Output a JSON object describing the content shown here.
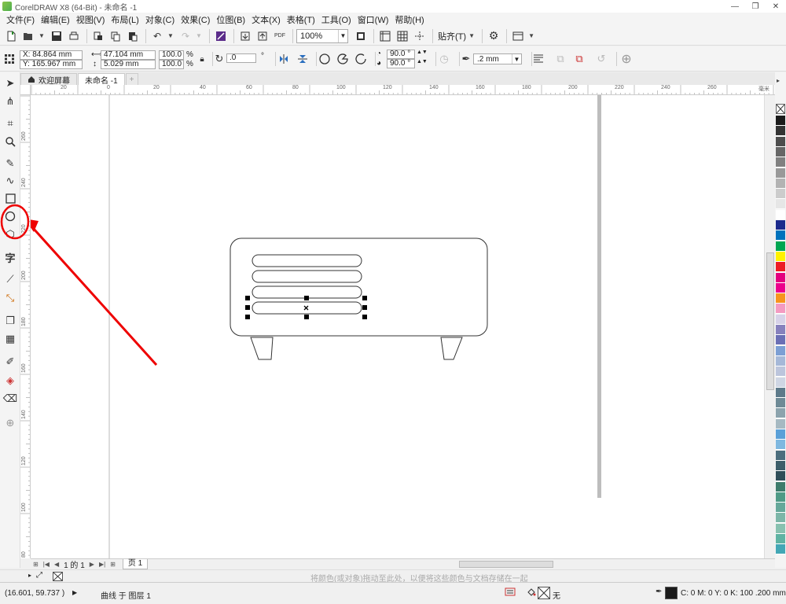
{
  "titlebar": {
    "title": "CorelDRAW X8 (64-Bit) - 未命名 -1",
    "min": "—",
    "restore": "❐",
    "close": "✕"
  },
  "menus": [
    "文件(F)",
    "编辑(E)",
    "视图(V)",
    "布局(L)",
    "对象(C)",
    "效果(C)",
    "位图(B)",
    "文本(X)",
    "表格(T)",
    "工具(O)",
    "窗口(W)",
    "帮助(H)"
  ],
  "toolbar": {
    "pdf_label": "PDF",
    "zoom": "100%",
    "snap_label": "贴齐(T)"
  },
  "propbar": {
    "x": "X: 84.864 mm",
    "y": "Y: 165.967 mm",
    "width": "47.104 mm",
    "height": "5.029 mm",
    "scale_x": "100.0",
    "scale_y": "100.0",
    "percent": "%",
    "rotation": ".0",
    "degree_symbol": "°",
    "start_angle": "90.0 °",
    "end_angle": "90.0 °",
    "outline": ".2 mm"
  },
  "tabs": {
    "welcome": "欢迎屏幕",
    "document": "未命名 -1",
    "add": "+"
  },
  "ruler": {
    "h_labels": [
      "20",
      "0",
      "20",
      "40",
      "60",
      "80",
      "100",
      "120",
      "140",
      "160",
      "180",
      "200",
      "220",
      "240",
      "260"
    ],
    "v_labels": [
      "260",
      "240",
      "220",
      "200",
      "180",
      "160",
      "140",
      "120",
      "100",
      "80"
    ],
    "unit": "毫米"
  },
  "pagebar": {
    "pages": "1 的 1",
    "page_tab": "页 1"
  },
  "hint": "将颜色(或对象)拖动至此处，以便将这些颜色与文档存储在一起",
  "status": {
    "coords": "(16.601, 59.737 )",
    "object": "曲线 于 图层 1",
    "fill": "无",
    "color_info": "C: 0 M: 0 Y: 0 K: 100 .200 mm"
  },
  "palette": [
    "#1a1a1a",
    "#333333",
    "#4d4d4d",
    "#666666",
    "#808080",
    "#999999",
    "#b3b3b3",
    "#cccccc",
    "#e6e6e6",
    "#ffffff",
    "#1b2a8c",
    "#0072bc",
    "#00a651",
    "#fff200",
    "#ed1c24",
    "#e4007f",
    "#ec008c",
    "#f7941d",
    "#f49ac1",
    "#d7d2e8",
    "#8781bd",
    "#6b6fb5",
    "#7c9fd4",
    "#a5b8d8",
    "#bcc5dc",
    "#cfd6e4",
    "#5d7a8a",
    "#6e8a96",
    "#8ca3ad",
    "#a6b9c2",
    "#5aa0d8",
    "#7fb8e0",
    "#4c6e7e",
    "#3d5e6a",
    "#2f4e59",
    "#3e7c6c",
    "#4f9a86",
    "#66a89a",
    "#7db6a8",
    "#88c1b0",
    "#5fb3a3",
    "#43a7b5"
  ]
}
